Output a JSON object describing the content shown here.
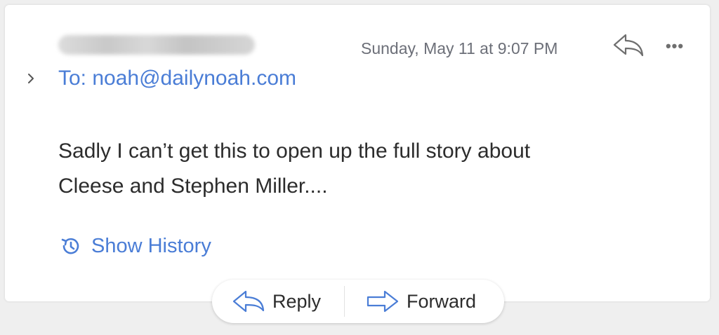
{
  "message": {
    "date": "Sunday, May 11 at 9:07 PM",
    "to_line": "To: noah@dailynoah.com",
    "body_line1": "Sadly I can’t get this to open up the full story about",
    "body_line2": "Cleese and Stephen Miller...."
  },
  "header_icons": {
    "reply": "reply-arrow-icon",
    "more": "•••",
    "expand": "chevron-right-icon"
  },
  "history": {
    "label": "Show History",
    "icon": "history-clock-icon"
  },
  "actions": {
    "reply_label": "Reply",
    "forward_label": "Forward"
  },
  "colors": {
    "link": "#4a7dd6",
    "text": "#2c2c2c",
    "meta": "#6c6f78"
  }
}
